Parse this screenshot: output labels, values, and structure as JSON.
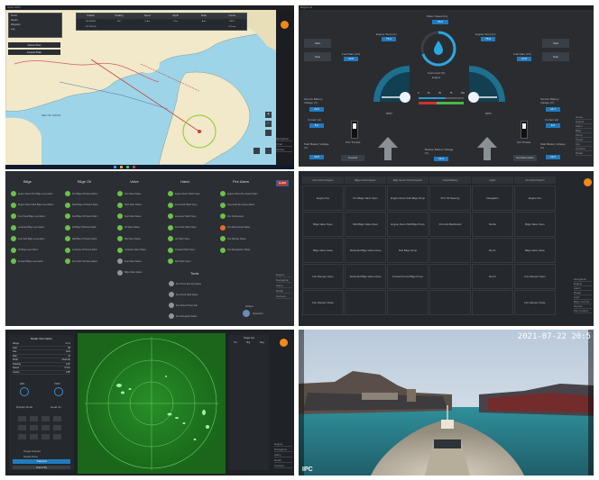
{
  "panels": {
    "chart": {
      "title": "Open CPN",
      "info_rows": [
        "Route",
        "Depart",
        "Waypoint",
        "Leg"
      ],
      "table_headers": [
        "Position",
        "Heading",
        "Speed",
        "Depth",
        "Mode",
        "Course"
      ],
      "table_row1": [
        "36°19.89 N",
        "142°",
        "6.4kn",
        "9.7m",
        "Auto",
        "138.2°"
      ],
      "table_row2": [
        "127°39.51 E",
        "",
        "",
        "",
        "",
        "12.5 nm"
      ],
      "route_button": "Route Plan",
      "cancel_button": "Cancel Plan",
      "sea_label": "SEA OF JAPAN",
      "status": [
        "Navigation",
        "Chart",
        "Vessel"
      ]
    },
    "engine": {
      "title": "Engine UI",
      "left_buttons": [
        "Start",
        "Stop"
      ],
      "right_buttons": [
        "Start",
        "Stop"
      ],
      "water_speed_label": "Water Speed (kn)",
      "water_speed_value": "15.2",
      "engine_temp_label": "Engine Temp (C)",
      "engine_temp_left": "76.4",
      "engine_temp_right": "75.9",
      "fuel_rate_label": "Fuel Rate (L/h)",
      "fuel_rate_left": "12.6",
      "fuel_rate_right": "12.8",
      "fuel_center_label": "Fuel Level (%)",
      "fuel_center_value": "Engine",
      "rpm_label": "RPM",
      "rpm_scale": [
        "0",
        "25",
        "50",
        "75",
        "100"
      ],
      "battery_label": "Service Battery Voltage (V)",
      "battery_left": "12.6",
      "battery_right": "12.7",
      "current_label": "Current (A)",
      "current_left": "8.2",
      "current_right": "8.4",
      "throttle_label": "Port Throttle",
      "throttle_right_label": "Stb Throttle",
      "start_battery_label": "Start Battery Voltage (V)",
      "start_battery_left": "12.5",
      "start_battery_right": "12.6",
      "backup_label": "Backup Battery Voltage (V)",
      "backup_value": "12.4",
      "mode_left": "Neutral",
      "mode_right": "Fire Detect Active",
      "side": [
        "Home",
        "Engine",
        "Alarm",
        "Bilge",
        "Pump",
        "Power",
        "Fire",
        "Camera",
        "Radar"
      ]
    },
    "alarms": {
      "columns": [
        {
          "title": "Bilge",
          "items": [
            "Engine Room Port Bilge Level Alarm",
            "Engine Room Stbd Bilge Level Alarm",
            "Fore Peak Bilge Level Alarm",
            "Lazarette Bilge Level Alarm",
            "Fuel Tank Bilge Level Alarm",
            "Aft Bilge Level Alarm",
            "Forward Bilge Level Alarm"
          ]
        },
        {
          "title": "Bilge Oil",
          "items": [
            "Port Bilge Oil Detect Alarm",
            "Stbd Bilge Oil Detect Alarm",
            "Fwd Bilge Oil Detect Alarm",
            "Aft Bilge Oil Detect Alarm",
            "Mid Bilge Oil Detect Alarm",
            "Lazarette Oil Detect Alarm",
            "Fuel Tank Oil Detect Alarm"
          ]
        },
        {
          "title": "Valve",
          "items": [
            "Port Valve Status",
            "Stbd Valve Status",
            "Fwd Valve Status",
            "Aft Valve Status",
            "Mid Valve Status",
            "Lazarette Valve Status",
            "Fuel Valve Status",
            "Bilge Valve Status"
          ]
        },
        {
          "title": "Hatch",
          "items": [
            "Engine Room Hatch Open",
            "Fore Peak Hatch Open",
            "Lazarette Hatch Open",
            "Fuel Tank Hatch Open",
            "Aft Hatch Open",
            "Forward Hatch Open",
            "Mid Hatch Open"
          ]
        },
        {
          "title": "Fire Alarm",
          "items": [
            "Engine Room Fire Detect Alarm",
            "Fore Peak Fire Detect Alarm",
            "Fire Suppression",
            "Fire Alarm Reset Status",
            "Fire Damper Status",
            "Fire Extinguisher Status"
          ]
        }
      ],
      "tools_title": "Tools",
      "tools": [
        "Fire Pump Running Status",
        "Fire Pump Fault Status",
        "Fire Detect Power Fail",
        "Fire Extinguish Status"
      ],
      "badge": "ALARM",
      "user_name": "Operator",
      "user_status": "Online",
      "side": [
        "Engine",
        "Navigation",
        "Alarm",
        "Radar",
        "Camera"
      ]
    },
    "controls": {
      "headers": [
        "Fore Control System",
        "Bilge Control System",
        "Bilge Sensor Control System",
        "Control Battery",
        "Lights",
        "Air Control System"
      ],
      "rows": [
        [
          "Engine Fire",
          "Port Bilge Valve Open",
          "Engine Room Fwd Bilge Pump",
          "Port Tilt Steering",
          "Navigation",
          "Engine Fire"
        ],
        [
          "Bilge Valve Open",
          "Stbd Bilge Valve Open",
          "Engine Room Mid Bilge Pump",
          "Port Anti Backboard",
          "Strobe",
          "Bilge Valve Open"
        ],
        [
          "Bilge Valve Close",
          "Starboard Bilge Valve Close",
          "Fwd Bilge Pump",
          "",
          "Red 1",
          "Bilge Valve Close"
        ],
        [
          "Fire Damper Open",
          "Starboard Bilge Valve Close",
          "Forward Comp Bilge Pump",
          "",
          "Red 2",
          "Fire Damper Open"
        ],
        [
          "Fire Damper Close",
          "",
          "",
          "",
          "",
          "Fire Damper Close"
        ]
      ],
      "side": [
        "Navigation",
        "Engine",
        "Alarm",
        "Radar",
        "Light",
        "Bilge Control",
        "Sensor",
        "Fire Control"
      ]
    },
    "radar": {
      "info_title": "Radar Information",
      "info_rows": [
        [
          "Range",
          "6 nm"
        ],
        [
          "Gain",
          "68"
        ],
        [
          "Sea",
          "Auto"
        ],
        [
          "Rain",
          "12"
        ],
        [
          "Mode",
          "Head Up"
        ],
        [
          "Heading",
          "142°"
        ],
        [
          "Speed",
          "6.4 kn"
        ],
        [
          "Course",
          "138°"
        ]
      ],
      "bearing_label": "EBL",
      "vrm_label": "VRM",
      "mode_label": "Display Mode",
      "mode_value": "Head Up",
      "target_label": "Target Acquire",
      "guard_label": "Guard Zone",
      "transmit_button": "Transmit",
      "standby_button": "Stand By",
      "list_title": "Target List",
      "list_headers": [
        "No",
        "Brg",
        "Rng"
      ],
      "side": [
        "Engine",
        "Navigation",
        "Alarm",
        "Radar",
        "Camera"
      ]
    },
    "camera": {
      "timestamp": "2021-07-22 20:5",
      "overlay": "IPC"
    }
  },
  "colors": {
    "accent": "#1f7bbf",
    "alarm_orange": "#f08a1a",
    "radar_green": "#1f7a1f",
    "alarm_green": "#6cc04a"
  }
}
